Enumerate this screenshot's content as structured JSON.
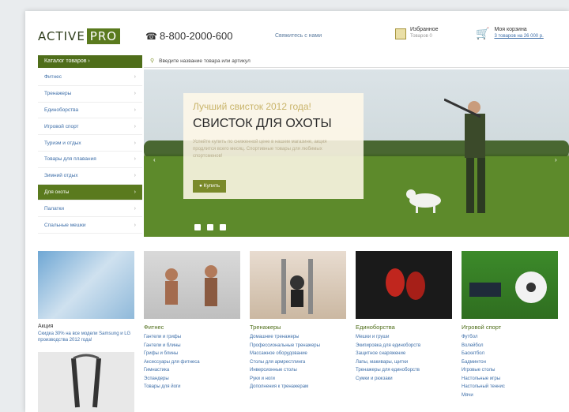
{
  "header": {
    "logo_active": "ACTIVE",
    "logo_pro": "PRO",
    "phone": "8-800-2000-600",
    "callback": "Свяжитесь с нами",
    "favorites_title": "Избранное",
    "favorites_sub": "Товаров 0",
    "cart_title": "Моя корзина",
    "cart_link": "3 товаров на 26 000 р."
  },
  "catalog_button": "Каталог товаров",
  "search": {
    "placeholder": "Введите название товара или артикул"
  },
  "sidebar": {
    "items": [
      {
        "label": "Фитнес"
      },
      {
        "label": "Тренажеры"
      },
      {
        "label": "Единоборства"
      },
      {
        "label": "Игровой спорт"
      },
      {
        "label": "Туризм и отдых"
      },
      {
        "label": "Товары для плавания"
      },
      {
        "label": "Зимний отдых"
      },
      {
        "label": "Для охоты"
      },
      {
        "label": "Палатки"
      },
      {
        "label": "Спальные мешки"
      }
    ]
  },
  "hero": {
    "kicker": "Лучший свисток 2012 года!",
    "title": "СВИСТОК ДЛЯ ОХОТЫ",
    "description": "Успейте купить по сниженной цене в нашем магазине, акция продлится всего месяц. Спортивные товары для любимых спортсменов!",
    "button": "Купить"
  },
  "promo_tile": {
    "title": "Акция",
    "text": "Скидка 30% на все модели Samsung и LG производства 2012 года!"
  },
  "categories": [
    {
      "title": "Фитнес",
      "links": [
        "Гантели и грифы",
        "Гантели и блины",
        "Грифы и блины",
        "Аксессуары для фитнеса",
        "Гимнастика",
        "Эспандеры",
        "Товары для йоги"
      ]
    },
    {
      "title": "Тренажеры",
      "links": [
        "Домашние тренажеры",
        "Профессиональные тренажеры",
        "Массажное оборудование",
        "Столы для армрестлинга",
        "Инверсионные столы",
        "Руки и ноги",
        "Дополнения к тренажерам"
      ]
    },
    {
      "title": "Единоборства",
      "links": [
        "Мешки и груши",
        "Экипировка для единоборств",
        "Защитное снаряжение",
        "Лапы, макивары, щитки",
        "Тренажеры для единоборств",
        "Сумки и рюкзаки"
      ]
    },
    {
      "title": "Игровой спорт",
      "links": [
        "Футбол",
        "Волейбол",
        "Баскетбол",
        "Бадминтон",
        "Игровые столы",
        "Настольные игры",
        "Настольный теннис",
        "Мячи"
      ]
    }
  ],
  "colors": {
    "brand_green": "#5a7a1e",
    "link_blue": "#3d6ea8"
  }
}
